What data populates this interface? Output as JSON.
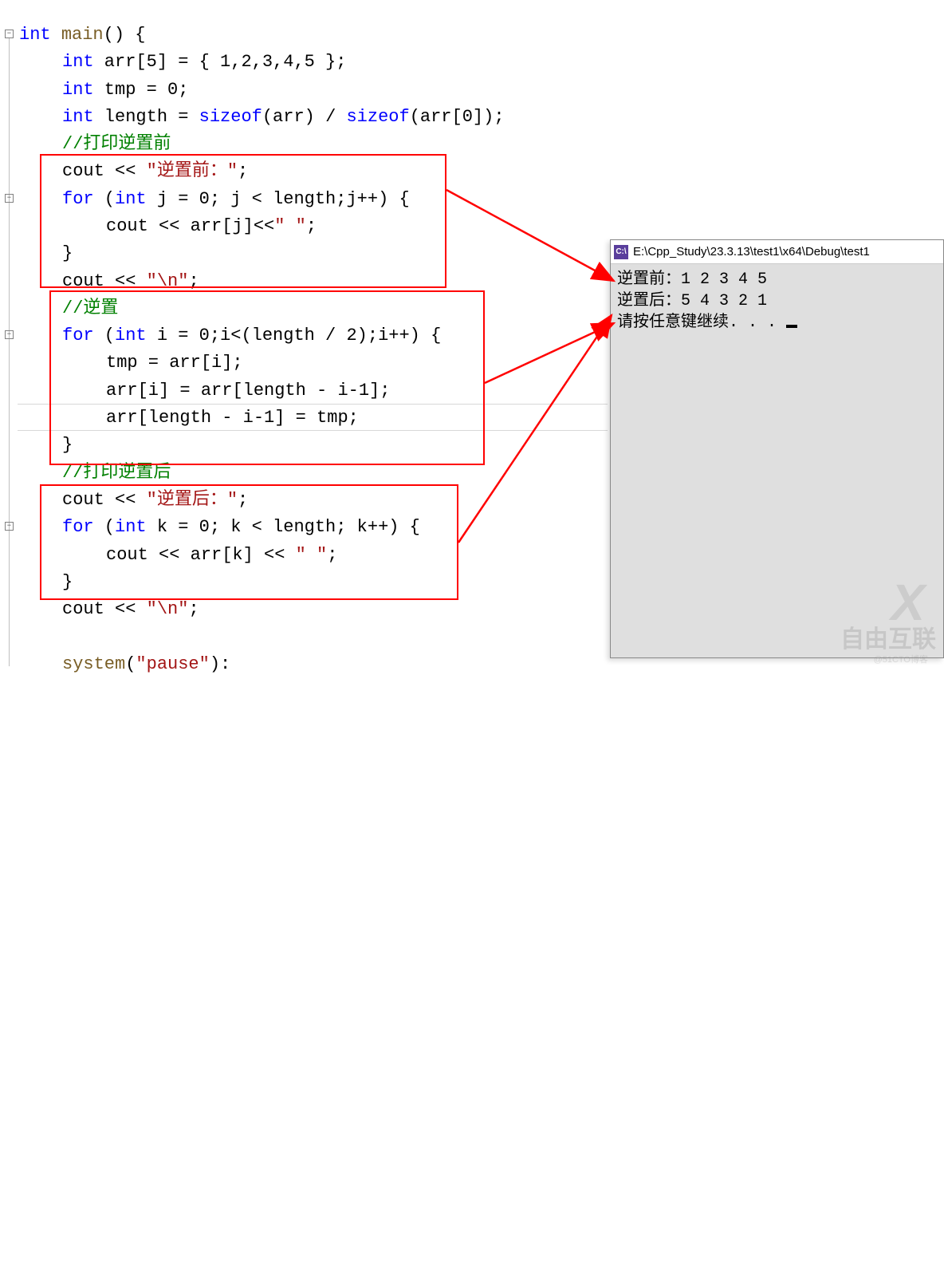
{
  "code": {
    "l1": {
      "kw1": "int",
      "fn": "main",
      "rest": "() {"
    },
    "l2": {
      "kw": "int",
      "rest1": " arr[5] = { 1,2,3,4,5 };"
    },
    "l3": {
      "kw": "int",
      "rest": " tmp = 0;"
    },
    "l4": {
      "kw": "int",
      "name": " length = ",
      "sz1": "sizeof",
      "p1": "(arr) / ",
      "sz2": "sizeof",
      "p2": "(arr[0]);"
    },
    "l5": {
      "cmt": "//打印逆置前"
    },
    "l6": {
      "id": "cout << ",
      "str": "\"逆置前：\"",
      "semi": ";"
    },
    "l7": {
      "kw1": "for",
      "p1": " (",
      "kw2": "int",
      "p2": " j = 0; j < length;j++) {"
    },
    "l8": {
      "body": "cout << arr[j]<<",
      "str": "\" \"",
      "semi": ";"
    },
    "l9": {
      "brace": "}"
    },
    "l10": {
      "id": "cout << ",
      "str": "\"\\n\"",
      "semi": ";"
    },
    "l11": {
      "cmt": "//逆置"
    },
    "l12": {
      "kw1": "for",
      "p1": " (",
      "kw2": "int",
      "p2": " i = 0;i<(length / 2);i++) {"
    },
    "l13": {
      "body": "tmp = arr[i];"
    },
    "l14": {
      "body": "arr[i] = arr[length - i-1];"
    },
    "l15": {
      "body": "arr[length - i-1] = tmp;"
    },
    "l16": {
      "brace": "}"
    },
    "l17": {
      "cmt": "//打印逆置后"
    },
    "l18": {
      "id": "cout << ",
      "str": "\"逆置后：\"",
      "semi": ";"
    },
    "l19": {
      "kw1": "for",
      "p1": " (",
      "kw2": "int",
      "p2": " k = 0; k < length; k++) {"
    },
    "l20": {
      "body": "cout << arr[k] << ",
      "str": "\" \"",
      "semi": ";"
    },
    "l21": {
      "brace": "}"
    },
    "l22": {
      "id": "cout << ",
      "str": "\"\\n\"",
      "semi": ";"
    },
    "l24": {
      "fn": "system",
      "p": "(",
      "str": "\"pause\"",
      "tail": "):"
    }
  },
  "console": {
    "title": "E:\\Cpp_Study\\23.3.13\\test1\\x64\\Debug\\test1",
    "out1": "逆置前：1 2 3 4 5",
    "out2": "逆置后：5 4 3 2 1",
    "out3": "请按任意键继续. . . "
  },
  "watermark": {
    "brand": "自由互联",
    "credit": "@51CTO博客"
  }
}
